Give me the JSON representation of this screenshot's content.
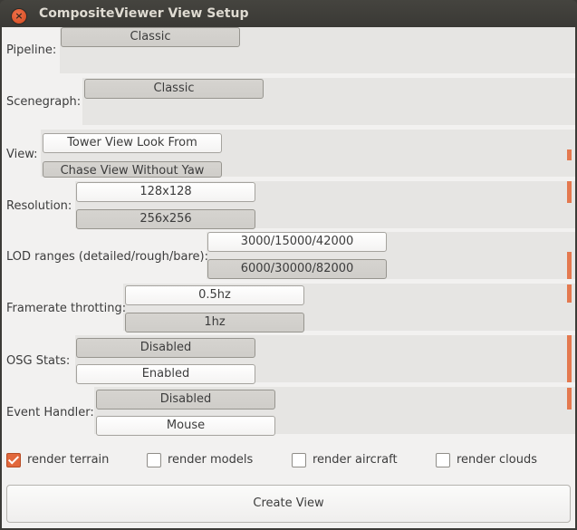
{
  "window": {
    "title": "CompositeViewer View Setup",
    "close_label": "×"
  },
  "rows": {
    "pipeline": {
      "label": "Pipeline:",
      "buttons": [
        "Classic"
      ]
    },
    "scenegraph": {
      "label": "Scenegraph:",
      "buttons": [
        "Classic"
      ]
    },
    "view": {
      "label": "View:",
      "buttons": [
        "Tower View Look From",
        "Chase View Without Yaw"
      ]
    },
    "resolution": {
      "label": "Resolution:",
      "buttons": [
        "128x128",
        "256x256"
      ]
    },
    "lod": {
      "label": "LOD ranges (detailed/rough/bare):",
      "buttons": [
        "3000/15000/42000",
        "6000/30000/82000"
      ]
    },
    "framerate": {
      "label": "Framerate throtting:",
      "buttons": [
        "0.5hz",
        "1hz"
      ]
    },
    "osgstats": {
      "label": "OSG Stats:",
      "buttons": [
        "Disabled",
        "Enabled"
      ]
    },
    "eventhandler": {
      "label": "Event Handler:",
      "buttons": [
        "Disabled",
        "Mouse"
      ]
    }
  },
  "checkboxes": [
    {
      "label": "render terrain",
      "checked": true
    },
    {
      "label": "render models",
      "checked": false
    },
    {
      "label": "render aircraft",
      "checked": false
    },
    {
      "label": "render clouds",
      "checked": false
    }
  ],
  "create_button": "Create View",
  "colors": {
    "accent": "#e2683c",
    "titlebar": "#3c3b37",
    "panel": "#e6e5e3",
    "background": "#f2f1f0"
  }
}
